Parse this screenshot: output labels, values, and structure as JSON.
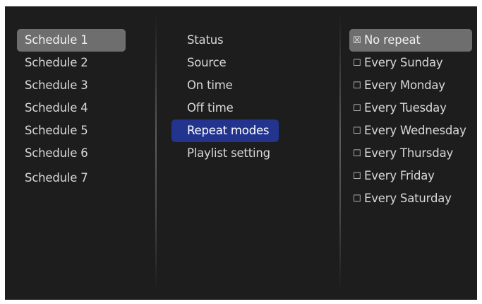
{
  "schedules": [
    {
      "label": "Schedule 1",
      "selected": true
    },
    {
      "label": "Schedule 2",
      "selected": false
    },
    {
      "label": "Schedule 3",
      "selected": false
    },
    {
      "label": "Schedule 4",
      "selected": false
    },
    {
      "label": "Schedule 5",
      "selected": false
    },
    {
      "label": "Schedule 6",
      "selected": false
    },
    {
      "label": "Schedule 7",
      "selected": false
    }
  ],
  "settings": [
    {
      "label": "Status",
      "active": false
    },
    {
      "label": "Source",
      "active": false
    },
    {
      "label": "On time",
      "active": false
    },
    {
      "label": "Off time",
      "active": false
    },
    {
      "label": "Repeat modes",
      "active": true
    },
    {
      "label": "Playlist setting",
      "active": false
    }
  ],
  "repeat_options": [
    {
      "checkbox": "☒",
      "label": "No repeat",
      "checked": true
    },
    {
      "checkbox": "☐",
      "label": "Every Sunday",
      "checked": false
    },
    {
      "checkbox": "☐",
      "label": "Every Monday",
      "checked": false
    },
    {
      "checkbox": "☐",
      "label": "Every Tuesday",
      "checked": false
    },
    {
      "checkbox": "☐",
      "label": "Every Wednesday",
      "checked": false
    },
    {
      "checkbox": "☐",
      "label": "Every Thursday",
      "checked": false
    },
    {
      "checkbox": "☐",
      "label": "Every Friday",
      "checked": false
    },
    {
      "checkbox": "☐",
      "label": "Every Saturday",
      "checked": false
    }
  ],
  "colors": {
    "background": "#1d1d1d",
    "text": "#d8d8d8",
    "highlight_gray": "#6e6e6e",
    "highlight_blue": "#23348f"
  }
}
